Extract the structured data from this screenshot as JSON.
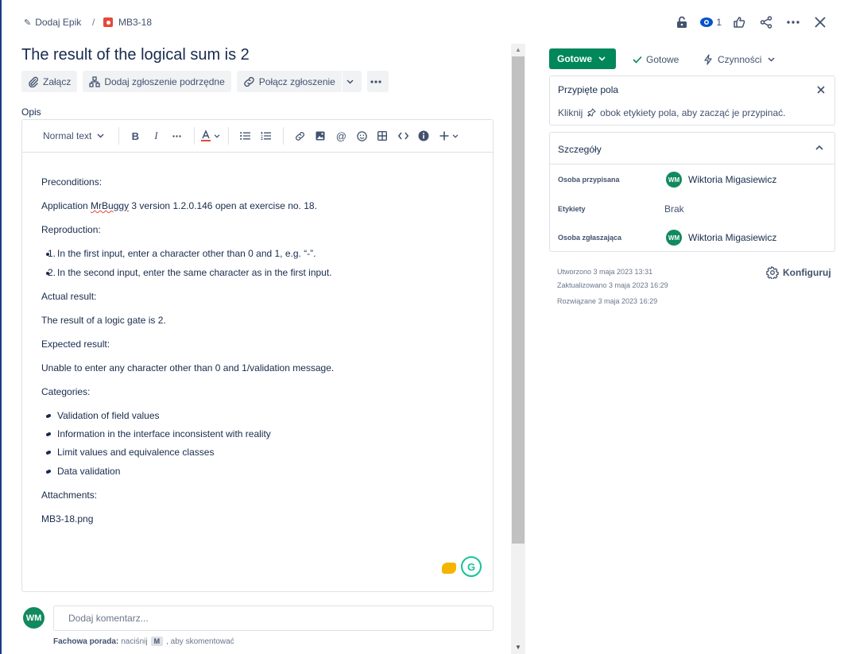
{
  "breadcrumb": {
    "epic_label": "Dodaj Epik",
    "separator": "/",
    "issue_key": "MB3-18"
  },
  "header": {
    "watch_count": "1"
  },
  "issue": {
    "title": "The result of the logical sum is 2"
  },
  "actions": {
    "attach": "Załącz",
    "add_child": "Dodaj zgłoszenie podrzędne",
    "link_issue": "Połącz zgłoszenie"
  },
  "description": {
    "label": "Opis",
    "text_style": "Normal text",
    "lines": {
      "preconditions": "Preconditions:",
      "app_before": "Application ",
      "app_name": "MrBuggy",
      "app_after": " 3 version 1.2.0.146 open at exercise no. 18.",
      "reproduction": "Reproduction:",
      "step1": "In the first input, enter a character other than 0 and 1, e.g. “-”.",
      "step2": "In the second input, enter the same character as in the first input.",
      "actual_label": "Actual result:",
      "actual": "The result of a logic gate is 2.",
      "expected_label": "Expected result:",
      "expected": "Unable to enter any character other than 0 and 1/validation message.",
      "categories_label": "Categories:",
      "cat1": "Validation of field values",
      "cat2": "Information in the interface inconsistent with reality",
      "cat3": "Limit values and equivalence classes",
      "cat4": "Data validation",
      "attachments_label": "Attachments:",
      "attachment": "MB3-18.png"
    }
  },
  "comment": {
    "avatar_initials": "WM",
    "placeholder": "Dodaj komentarz...",
    "tip_bold": "Fachowa porada:",
    "tip_before": "naciśnij",
    "tip_key": "M",
    "tip_after": ", aby skomentować"
  },
  "status": {
    "button": "Gotowe",
    "resolution": "Gotowe",
    "actions": "Czynności"
  },
  "pinned": {
    "title": "Przypięte pola",
    "hint_before": "Kliknij",
    "hint_after": "obok etykiety pola, aby zacząć je przypinać."
  },
  "details": {
    "title": "Szczegóły",
    "assignee_label": "Osoba przypisana",
    "assignee_initials": "WM",
    "assignee_name": "Wiktoria Migasiewicz",
    "labels_label": "Etykiety",
    "labels_value": "Brak",
    "reporter_label": "Osoba zgłaszająca",
    "reporter_initials": "WM",
    "reporter_name": "Wiktoria Migasiewicz"
  },
  "meta": {
    "created": "Utworzono 3 maja 2023 13:31",
    "updated": "Zaktualizowano 3 maja 2023 16:29",
    "resolved": "Rozwiązane 3 maja 2023 16:29",
    "configure": "Konfiguruj"
  },
  "colors": {
    "status_green": "#00875a",
    "avatar_green": "#108a5e",
    "bug_red": "#e5493a",
    "text_primary": "#172b4d"
  }
}
